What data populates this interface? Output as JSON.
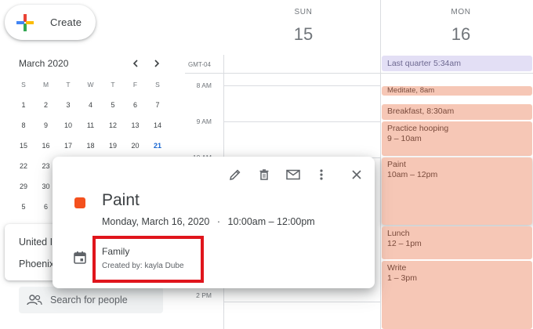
{
  "create": {
    "label": "Create",
    "icon": "plus-icon"
  },
  "mini_calendar": {
    "title": "March 2020",
    "weekdays": [
      "S",
      "M",
      "T",
      "W",
      "T",
      "F",
      "S"
    ],
    "rows": [
      [
        "1",
        "2",
        "3",
        "4",
        "5",
        "6",
        "7"
      ],
      [
        "8",
        "9",
        "10",
        "11",
        "12",
        "13",
        "14"
      ],
      [
        "15",
        "16",
        "17",
        "18",
        "19",
        "20",
        "21"
      ],
      [
        "22",
        "23",
        "",
        "",
        "",
        "",
        ""
      ],
      [
        "29",
        "30",
        "",
        "",
        "",
        "",
        ""
      ],
      [
        "5",
        "6",
        "",
        "",
        "",
        "",
        ""
      ]
    ],
    "selected": "21",
    "prev_icon": "chevron-left-icon",
    "next_icon": "chevron-right-icon"
  },
  "time_card": {
    "line1": "United I",
    "line2": "Phoenix"
  },
  "search_people": {
    "placeholder": "Search for people",
    "icon": "people-icon"
  },
  "days": [
    {
      "dow": "SUN",
      "num": "15"
    },
    {
      "dow": "MON",
      "num": "16"
    }
  ],
  "timezone": "GMT-04",
  "time_labels": [
    "8 AM",
    "9 AM",
    "10 AM",
    "2 PM"
  ],
  "events": {
    "allday": "Last quarter 5:34am",
    "meditate": "Meditate, 8am",
    "breakfast": "Breakfast, 8:30am",
    "hooping": {
      "title": "Practice hooping",
      "time": "9 – 10am"
    },
    "paint": {
      "title": "Paint",
      "time": "10am – 12pm"
    },
    "lunch": {
      "title": "Lunch",
      "time": "12 – 1pm"
    },
    "write": {
      "title": "Write",
      "time": "1 – 3pm"
    }
  },
  "popup": {
    "title": "Paint",
    "date": "Monday, March 16, 2020",
    "separator": "·",
    "time": "10:00am – 12:00pm",
    "calendar": "Family",
    "creator": "Created by: kayla Dube",
    "event_color": "#f4511e",
    "actions": [
      "edit-icon",
      "delete-icon",
      "email-icon",
      "more-options-icon",
      "close-icon"
    ]
  },
  "colors": {
    "event": "#f6c7b6",
    "allday": "#e3dff5",
    "highlight": "#e0151c",
    "selected_day": "#d2e3fc"
  }
}
